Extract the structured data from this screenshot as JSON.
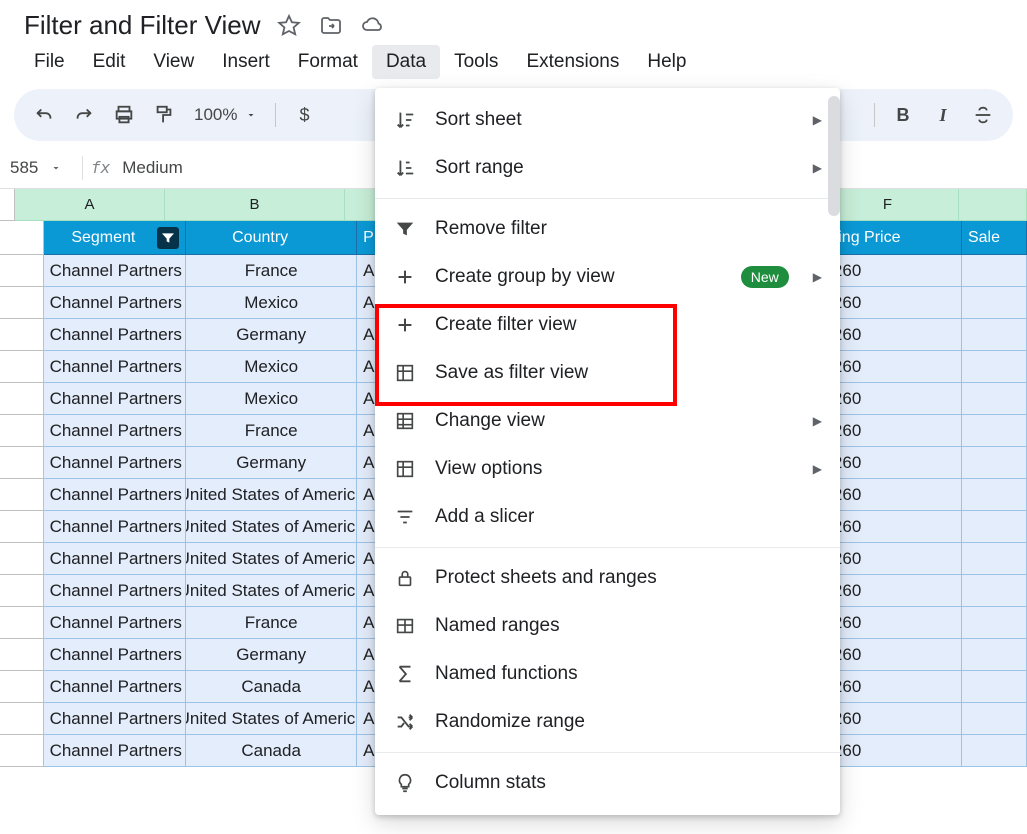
{
  "doc_title": "Filter and Filter View",
  "menus": {
    "file": "File",
    "edit": "Edit",
    "view": "View",
    "insert": "Insert",
    "format": "Format",
    "data": "Data",
    "tools": "Tools",
    "extensions": "Extensions",
    "help": "Help"
  },
  "toolbar": {
    "zoom": "100%",
    "currency": "$"
  },
  "formula": {
    "cell_ref": "585",
    "fx": "fx",
    "value": "Medium"
  },
  "cols": {
    "A": "A",
    "B": "B",
    "F": "F"
  },
  "headers": {
    "segment": "Segment",
    "country": "Country",
    "product": "Prod",
    "price": "ring Price",
    "sale": "Sale"
  },
  "segment_repeat": "Channel Partners",
  "am_prefix": "Am",
  "price_suffix": "260",
  "countries": [
    "France",
    "Mexico",
    "Germany",
    "Mexico",
    "Mexico",
    "France",
    "Germany",
    "United States of America",
    "United States of America",
    "United States of America",
    "United States of America",
    "France",
    "Germany",
    "Canada",
    "United States of America",
    "Canada"
  ],
  "dropdown": {
    "sort_sheet": "Sort sheet",
    "sort_range": "Sort range",
    "remove_filter": "Remove filter",
    "create_group": "Create group by view",
    "create_filter_view": "Create filter view",
    "save_filter_view": "Save as filter view",
    "change_view": "Change view",
    "view_options": "View options",
    "add_slicer": "Add a slicer",
    "protect": "Protect sheets and ranges",
    "named_ranges": "Named ranges",
    "named_functions": "Named functions",
    "randomize": "Randomize range",
    "column_stats": "Column stats",
    "new_badge": "New"
  }
}
